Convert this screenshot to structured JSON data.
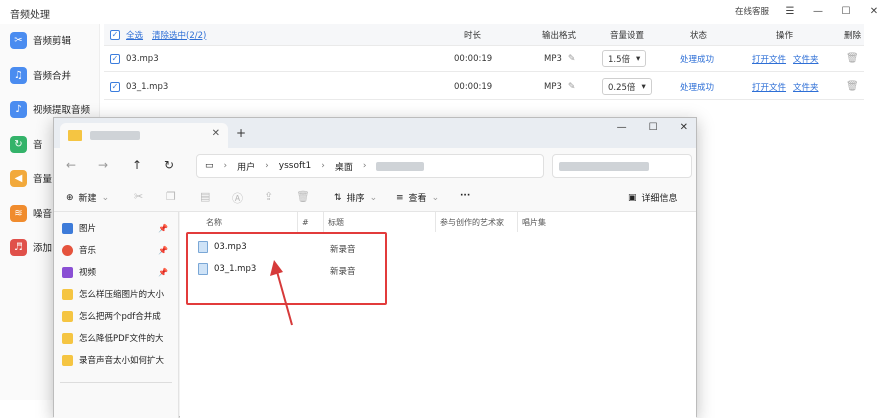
{
  "app": {
    "title": "音频处理",
    "support": "在线客服",
    "window_controls": [
      "☰",
      "—",
      "☐",
      "✕"
    ],
    "sidebar": [
      {
        "label": "音频剪辑",
        "icon": "scissors-icon",
        "color": "#4a8cf0"
      },
      {
        "label": "音频合并",
        "icon": "merge-icon",
        "color": "#4a8cf0"
      },
      {
        "label": "视频提取音频",
        "icon": "video-icon",
        "color": "#4a8cf0"
      },
      {
        "label": "音",
        "icon": "convert-icon",
        "color": "#34b36a"
      },
      {
        "label": "音量",
        "icon": "volume-icon",
        "color": "#f2a93b"
      },
      {
        "label": "噪音",
        "icon": "noise-icon",
        "color": "#f08c2e"
      },
      {
        "label": "添加",
        "icon": "add-audio-icon",
        "color": "#e0504a"
      }
    ],
    "table": {
      "header": {
        "select_all": "全选",
        "deselect": "清除选中(2/2)",
        "duration": "时长",
        "format": "输出格式",
        "volume": "音量设置",
        "status": "状态",
        "action": "操作",
        "delete": "删除"
      },
      "rows": [
        {
          "name": "03.mp3",
          "duration": "00:00:19",
          "format": "MP3",
          "volume": "1.5倍",
          "status": "处理成功",
          "open": "打开文件",
          "folder": "文件夹"
        },
        {
          "name": "03_1.mp3",
          "duration": "00:00:19",
          "format": "MP3",
          "volume": "0.25倍",
          "status": "处理成功",
          "open": "打开文件",
          "folder": "文件夹"
        }
      ]
    }
  },
  "explorer": {
    "newtab": "+",
    "controls": [
      "—",
      "☐",
      "✕"
    ],
    "breadcrumb": [
      "用户",
      "yssoft1",
      "桌面"
    ],
    "more": "···",
    "commands": {
      "new": "新建",
      "sort": "排序",
      "view": "查看",
      "more": "···",
      "details": "详细信息"
    },
    "nav": [
      {
        "label": "图片",
        "color": "#3d7bd9",
        "pinned": true
      },
      {
        "label": "音乐",
        "color": "#e5533d",
        "pinned": true
      },
      {
        "label": "视频",
        "color": "#8a4fd4",
        "pinned": true
      },
      {
        "label": "怎么样压缩图片的大小",
        "color": "#f5c542",
        "pinned": false
      },
      {
        "label": "怎么把两个pdf合并成",
        "color": "#f5c542",
        "pinned": false
      },
      {
        "label": "怎么降低PDF文件的大",
        "color": "#f5c542",
        "pinned": false
      },
      {
        "label": "录音声音太小如何扩大",
        "color": "#f5c542",
        "pinned": false
      }
    ],
    "columns": {
      "name": "名称",
      "num": "#",
      "title": "标题",
      "artist": "参与创作的艺术家",
      "album": "唱片集"
    },
    "files": [
      {
        "name": "03.mp3",
        "title": "新录音"
      },
      {
        "name": "03_1.mp3",
        "title": "新录音"
      }
    ]
  },
  "colors": {
    "accent": "#2e6fd6",
    "highlight": "#e23b3b"
  }
}
